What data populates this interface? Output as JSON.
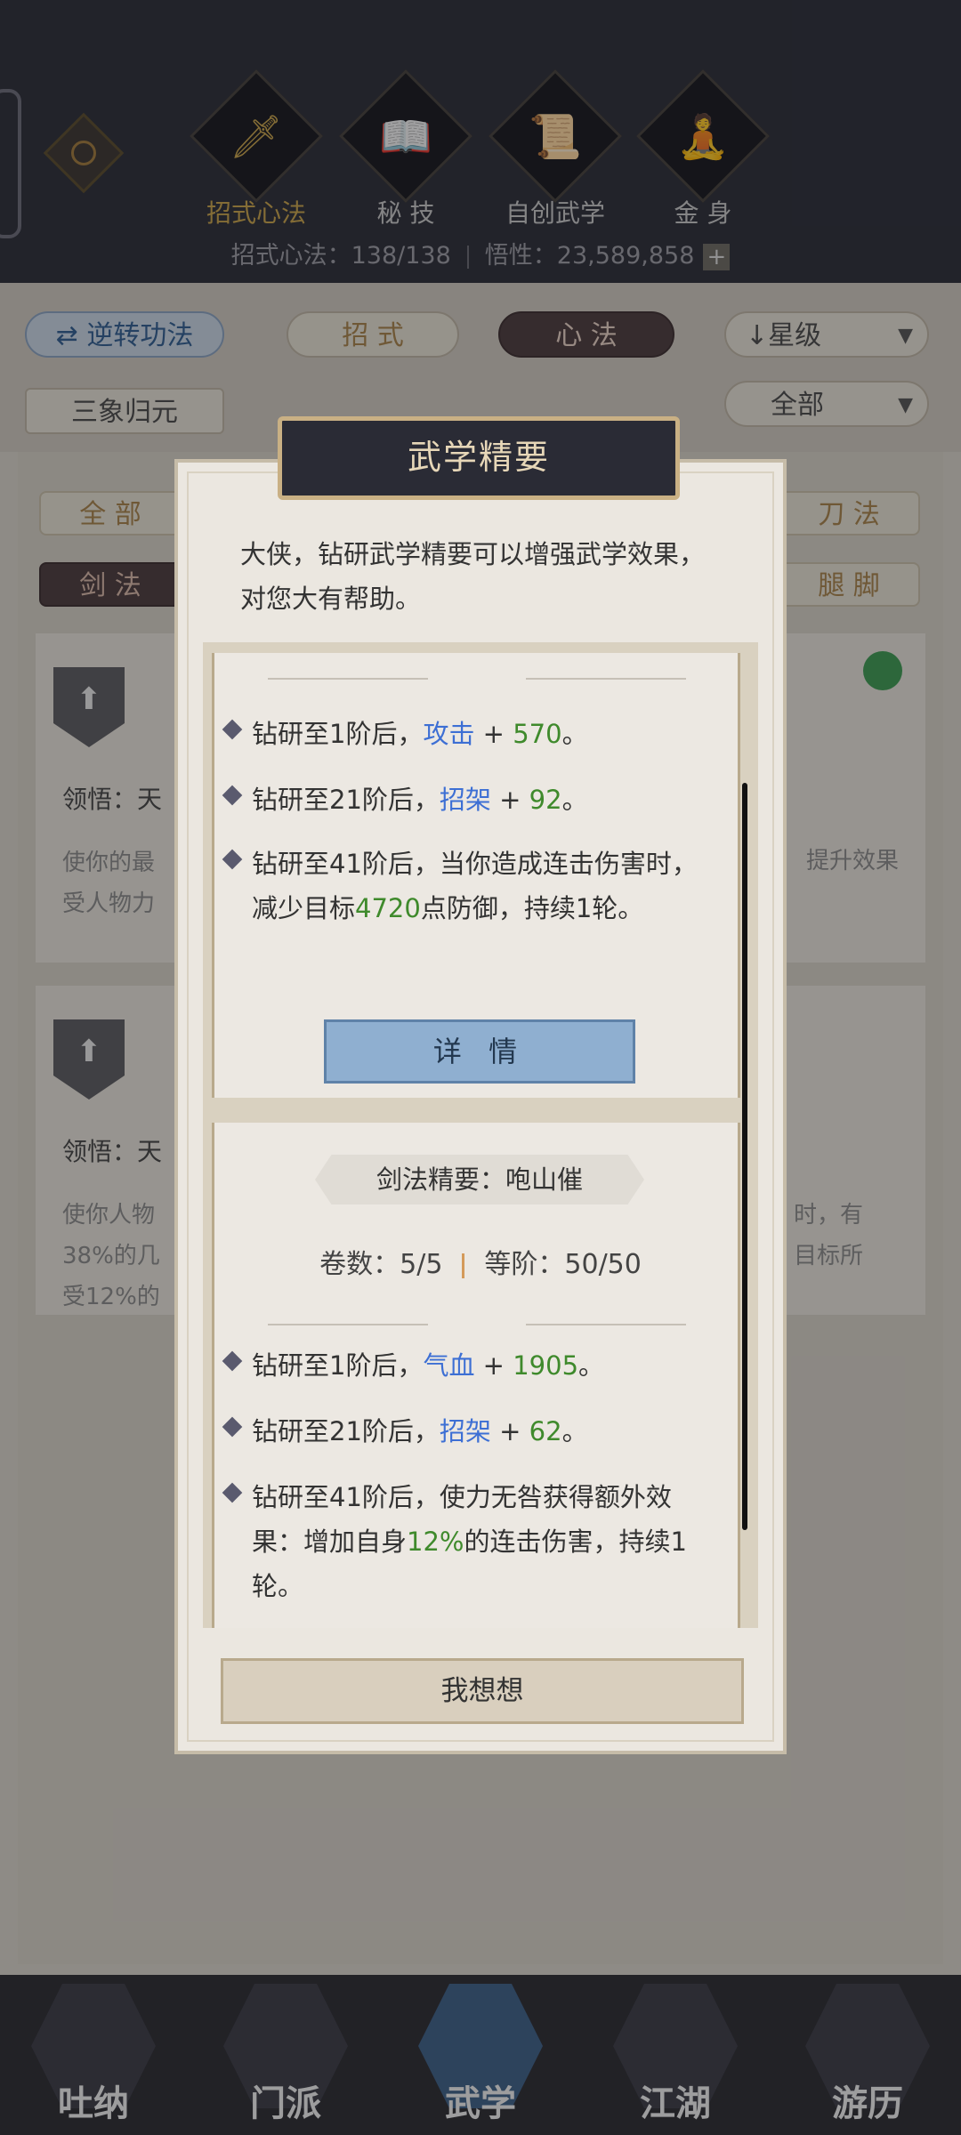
{
  "top": {
    "tabs": [
      {
        "label": "招式心法",
        "icon": "sword-icon",
        "glyph": "🗡",
        "active": true
      },
      {
        "label": "秘 技",
        "icon": "book-icon",
        "glyph": "📖",
        "active": false
      },
      {
        "label": "自创武学",
        "icon": "scroll-icon",
        "glyph": "📜",
        "active": false
      },
      {
        "label": "金 身",
        "icon": "meditation-icon",
        "glyph": "🧘",
        "active": false
      }
    ],
    "stat_progress": "招式心法：138/138",
    "stat_insight": "悟性：23,589,858",
    "plus": "+"
  },
  "filters": {
    "reverse": "⇄ 逆转功法",
    "zhaoshi": "招 式",
    "xinfa": "心 法",
    "sort": "↓星级",
    "sanxiang": "三象归元",
    "all": "全部",
    "arrow": "▼"
  },
  "categories": {
    "all": "全 部",
    "sword": "剑 法",
    "blade": "刀 法",
    "leg": "腿 脚"
  },
  "cards": [
    {
      "lingwu": "领悟：天",
      "desc_left": "使你的最",
      "desc_left2": "受人物力",
      "desc_right": "提升效果"
    },
    {
      "lingwu": "领悟：天",
      "desc_left": "使你人物",
      "desc_left2": "38%的几",
      "desc_left3": "受12%的",
      "desc_right": "时，有",
      "desc_right2": "目标所"
    }
  ],
  "modal": {
    "title": "武学精要",
    "intro": "大侠，钻研武学精要可以增强武学效果，对您大有帮助。",
    "panel1": {
      "e1_pre": "钻研至1阶后，",
      "e1_attr": "攻击",
      "e1_mid": " + ",
      "e1_val": "570",
      "e1_end": "。",
      "e2_pre": "钻研至21阶后，",
      "e2_attr": "招架",
      "e2_mid": " + ",
      "e2_val": "92",
      "e2_end": "。",
      "e3_pre": "钻研至41阶后，当你造成连击伤害时，减少目标",
      "e3_val": "4720",
      "e3_end": "点防御，持续1轮。",
      "detail": "详 情"
    },
    "panel2": {
      "banner": "剑法精要：咆山催",
      "volumes": "卷数：5/5",
      "rank": "等阶：50/50",
      "e1_pre": "钻研至1阶后，",
      "e1_attr": "气血",
      "e1_mid": " + ",
      "e1_val": "1905",
      "e1_end": "。",
      "e2_pre": "钻研至21阶后，",
      "e2_attr": "招架",
      "e2_mid": " + ",
      "e2_val": "62",
      "e2_end": "。",
      "e3_pre": "钻研至41阶后，使力无咎获得额外效果：增加自身",
      "e3_val": "12%",
      "e3_end": "的连击伤害，持续1轮。"
    },
    "think": "我想想"
  },
  "nav": [
    {
      "label": "吐纳",
      "active": false
    },
    {
      "label": "门派",
      "active": false
    },
    {
      "label": "武学",
      "active": true
    },
    {
      "label": "江湖",
      "active": false
    },
    {
      "label": "游历",
      "active": false
    }
  ],
  "colors": {
    "blue_attr": "#3d6fd4",
    "green_value": "#3f8a2c",
    "gold": "#c9a34a"
  }
}
